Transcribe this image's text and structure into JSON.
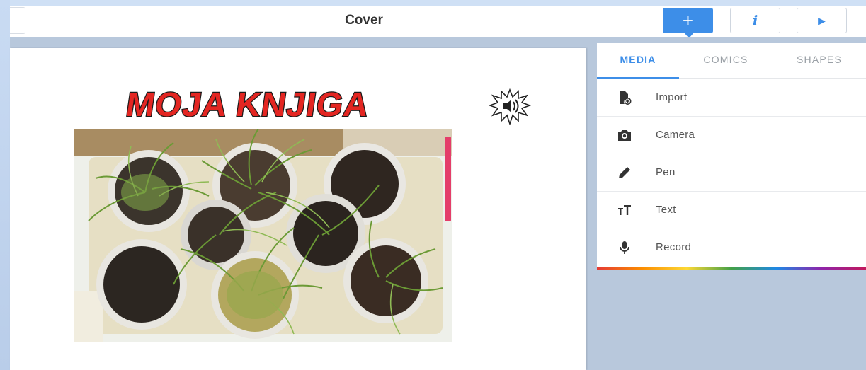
{
  "topbar": {
    "title": "Cover",
    "buttons": {
      "add_icon": "plus-icon",
      "info_icon": "info-icon",
      "play_icon": "play-icon"
    }
  },
  "page": {
    "book_title": "MOJA KNJIGA",
    "speaker_icon": "speaker-icon",
    "photo": "plants-in-pots-photo"
  },
  "panel": {
    "tabs": [
      {
        "label": "MEDIA",
        "active": true
      },
      {
        "label": "COMICS",
        "active": false
      },
      {
        "label": "SHAPES",
        "active": false
      }
    ],
    "items": [
      {
        "label": "Import",
        "icon": "import-file-icon"
      },
      {
        "label": "Camera",
        "icon": "camera-icon"
      },
      {
        "label": "Pen",
        "icon": "pen-icon"
      },
      {
        "label": "Text",
        "icon": "text-icon"
      },
      {
        "label": "Record",
        "icon": "microphone-icon"
      }
    ]
  },
  "colors": {
    "accent": "#3d8ee8",
    "title_red": "#e32622",
    "frame": "#dbe7f7"
  }
}
